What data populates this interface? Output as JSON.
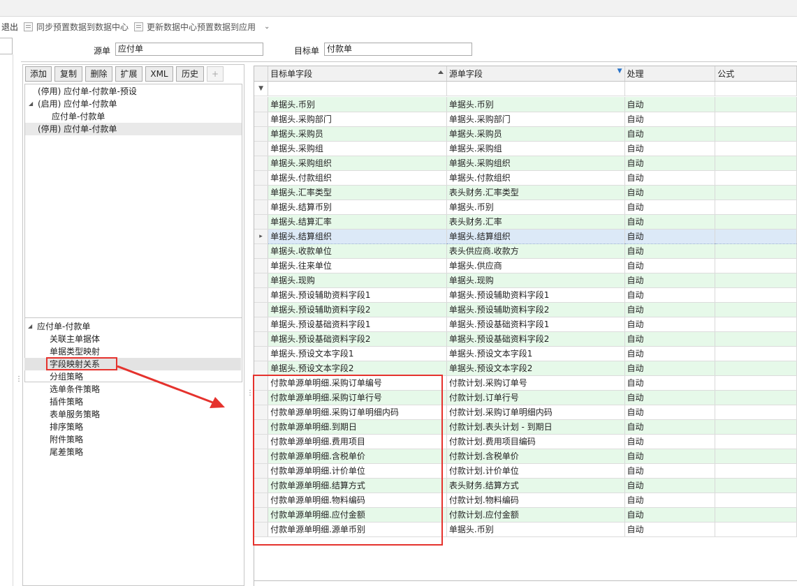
{
  "toolbar": {
    "exit": "退出",
    "sync": "同步预置数据到数据中心",
    "update": "更新数据中心预置数据到应用",
    "more_icon": "chevron-down-icon"
  },
  "form": {
    "source_label": "源单",
    "source_value": "应付单",
    "target_label": "目标单",
    "target_value": "付款单"
  },
  "left_buttons": [
    "添加",
    "复制",
    "删除",
    "扩展",
    "XML",
    "历史",
    "+"
  ],
  "tree_top": [
    {
      "label": "(停用) 应付单-付款单-预设",
      "expander": ""
    },
    {
      "label": "(启用) 应付单-付款单",
      "expander": "◢"
    },
    {
      "label": "应付单-付款单",
      "expander": ""
    },
    {
      "label": "(停用) 应付单-付款单",
      "expander": ""
    }
  ],
  "tree_bottom": {
    "root": "应付单-付款单",
    "items": [
      "关联主单据体",
      "单据类型映射",
      "字段映射关系",
      "分组策略",
      "选单条件策略",
      "插件策略",
      "表单服务策略",
      "排序策略",
      "附件策略",
      "尾差策略"
    ]
  },
  "grid": {
    "headers": [
      "目标单字段",
      "源单字段",
      "处理",
      "公式"
    ],
    "rows": [
      [
        "单据头.币别",
        "单据头.币别",
        "自动",
        ""
      ],
      [
        "单据头.采购部门",
        "单据头.采购部门",
        "自动",
        ""
      ],
      [
        "单据头.采购员",
        "单据头.采购员",
        "自动",
        ""
      ],
      [
        "单据头.采购组",
        "单据头.采购组",
        "自动",
        ""
      ],
      [
        "单据头.采购组织",
        "单据头.采购组织",
        "自动",
        ""
      ],
      [
        "单据头.付款组织",
        "单据头.付款组织",
        "自动",
        ""
      ],
      [
        "单据头.汇率类型",
        "表头财务.汇率类型",
        "自动",
        ""
      ],
      [
        "单据头.结算币别",
        "单据头.币别",
        "自动",
        ""
      ],
      [
        "单据头.结算汇率",
        "表头财务.汇率",
        "自动",
        ""
      ],
      [
        "单据头.结算组织",
        "单据头.结算组织",
        "自动",
        ""
      ],
      [
        "单据头.收款单位",
        "表头供应商.收款方",
        "自动",
        ""
      ],
      [
        "单据头.往来单位",
        "单据头.供应商",
        "自动",
        ""
      ],
      [
        "单据头.现购",
        "单据头.现购",
        "自动",
        ""
      ],
      [
        "单据头.预设辅助资料字段1",
        "单据头.预设辅助资料字段1",
        "自动",
        ""
      ],
      [
        "单据头.预设辅助资料字段2",
        "单据头.预设辅助资料字段2",
        "自动",
        ""
      ],
      [
        "单据头.预设基础资料字段1",
        "单据头.预设基础资料字段1",
        "自动",
        ""
      ],
      [
        "单据头.预设基础资料字段2",
        "单据头.预设基础资料字段2",
        "自动",
        ""
      ],
      [
        "单据头.预设文本字段1",
        "单据头.预设文本字段1",
        "自动",
        ""
      ],
      [
        "单据头.预设文本字段2",
        "单据头.预设文本字段2",
        "自动",
        ""
      ],
      [
        "付款单源单明细.采购订单编号",
        "付款计划.采购订单号",
        "自动",
        ""
      ],
      [
        "付款单源单明细.采购订单行号",
        "付款计划.订单行号",
        "自动",
        ""
      ],
      [
        "付款单源单明细.采购订单明细内码",
        "付款计划.采购订单明细内码",
        "自动",
        ""
      ],
      [
        "付款单源单明细.到期日",
        "付款计划.表头计划 - 到期日",
        "自动",
        ""
      ],
      [
        "付款单源单明细.费用项目",
        "付款计划.费用项目编码",
        "自动",
        ""
      ],
      [
        "付款单源单明细.含税单价",
        "付款计划.含税单价",
        "自动",
        ""
      ],
      [
        "付款单源单明细.计价单位",
        "付款计划.计价单位",
        "自动",
        ""
      ],
      [
        "付款单源单明细.结算方式",
        "表头财务.结算方式",
        "自动",
        ""
      ],
      [
        "付款单源单明细.物料编码",
        "付款计划.物料编码",
        "自动",
        ""
      ],
      [
        "付款单源单明细.应付金额",
        "付款计划.应付金额",
        "自动",
        ""
      ],
      [
        "付款单源单明细.源单币别",
        "单据头.币别",
        "自动",
        ""
      ]
    ]
  },
  "colors": {
    "row_green": "#e6f9e9",
    "row_selected": "#dce9f7",
    "highlight_red": "#e5322d"
  }
}
